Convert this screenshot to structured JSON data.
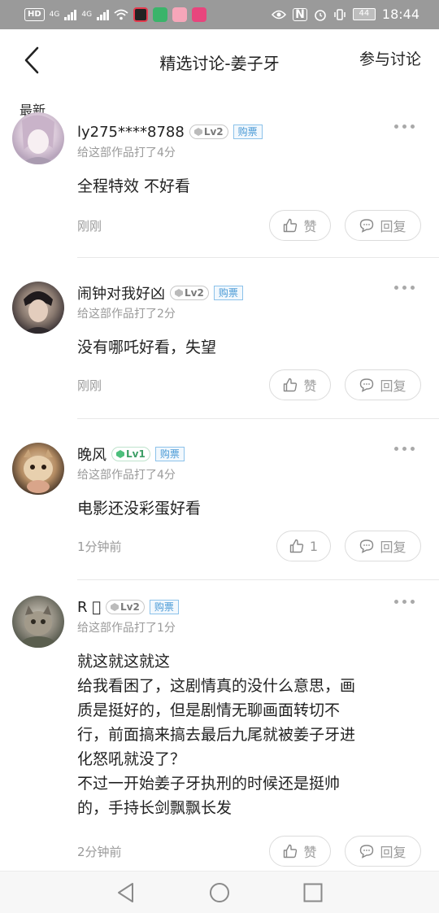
{
  "status_bar": {
    "left_chip": "HD",
    "net1": "4G",
    "net2": "4G",
    "nfc": "N",
    "battery": "44",
    "time": "18:44"
  },
  "header": {
    "title": "精选讨论-姜子牙",
    "join_label": "参与讨论"
  },
  "section_label": "最新",
  "comments": [
    {
      "username": "ly275****8788",
      "level": "Lv2",
      "buy_tag": "购票",
      "rating_text": "给这部作品打了4分",
      "body": [
        "全程特效 不好看"
      ],
      "time": "刚刚",
      "like_label": "赞",
      "reply_label": "回复"
    },
    {
      "username": "闹钟对我好凶",
      "level": "Lv2",
      "buy_tag": "购票",
      "rating_text": "给这部作品打了2分",
      "body": [
        "没有哪吒好看，失望"
      ],
      "time": "刚刚",
      "like_label": "赞",
      "reply_label": "回复"
    },
    {
      "username": "晚风",
      "level": "Lv1",
      "buy_tag": "购票",
      "rating_text": "给这部作品打了4分",
      "body": [
        "电影还没彩蛋好看"
      ],
      "time": "1分钟前",
      "like_label": "1",
      "reply_label": "回复"
    },
    {
      "username": "R 󰀀",
      "level": "Lv2",
      "buy_tag": "购票",
      "rating_text": "给这部作品打了1分",
      "body": [
        "就这就这就这",
        "给我看困了，这剧情真的没什么意思，画",
        "质是挺好的，但是剧情无聊画面转切不",
        "行，前面搞来搞去最后九尾就被姜子牙进",
        "化怒吼就没了？",
        "不过一开始姜子牙执刑的时候还是挺帅",
        "的，手持长剑飘飘长发"
      ],
      "time": "2分钟前",
      "like_label": "赞",
      "reply_label": "回复"
    }
  ],
  "colors": {
    "status_bar_bg": "#9a9a9a",
    "text_primary": "#222222",
    "text_secondary": "#9a9a9a",
    "buy_tag": "#4a9ad6",
    "lv1_green": "#3d9e66"
  },
  "icons": {
    "back": "chevron-left-icon",
    "more": "more-dots-icon",
    "like": "thumbs-up-icon",
    "reply": "speech-bubble-icon",
    "nav_back": "triangle-back-icon",
    "nav_home": "circle-home-icon",
    "nav_recent": "square-recent-icon"
  }
}
